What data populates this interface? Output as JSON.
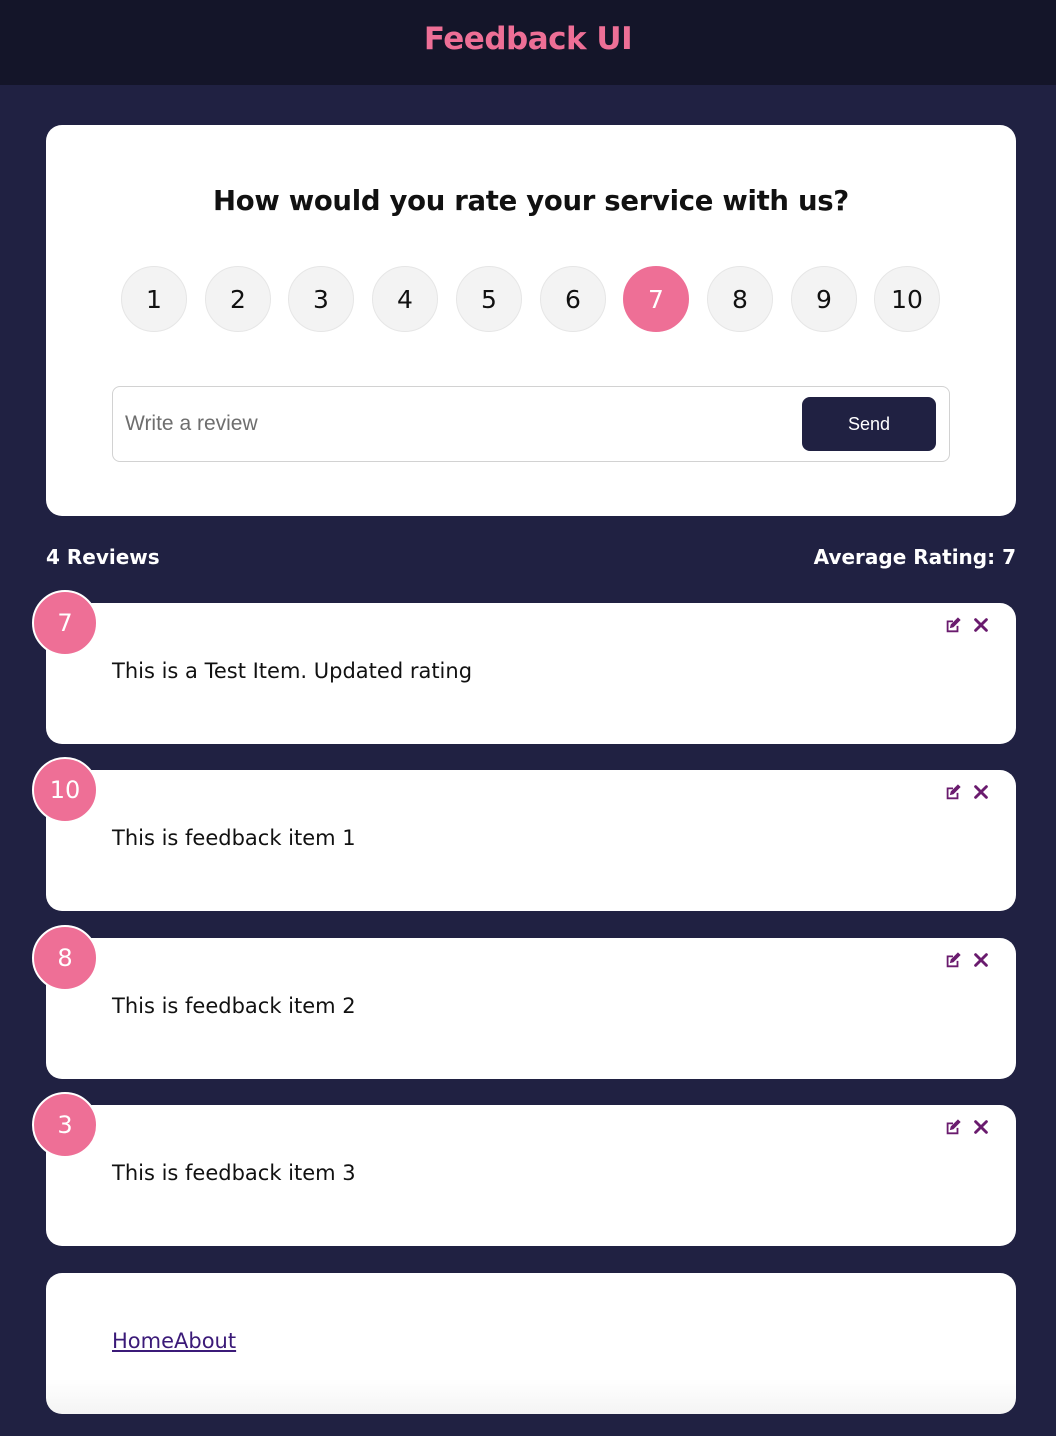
{
  "header": {
    "title": "Feedback UI"
  },
  "form": {
    "title": "How would you rate your service with us?",
    "ratings": [
      "1",
      "2",
      "3",
      "4",
      "5",
      "6",
      "7",
      "8",
      "9",
      "10"
    ],
    "selected_rating": "7",
    "review_placeholder": "Write a review",
    "send_label": "Send"
  },
  "stats": {
    "count_label": "4 Reviews",
    "average_label": "Average Rating: 7"
  },
  "items": [
    {
      "rating": "7",
      "text": "This is a Test Item. Updated rating"
    },
    {
      "rating": "10",
      "text": "This is feedback item 1"
    },
    {
      "rating": "8",
      "text": "This is feedback item 2"
    },
    {
      "rating": "3",
      "text": "This is feedback item 3"
    }
  ],
  "footer": {
    "home_label": "Home",
    "about_label": "About"
  },
  "colors": {
    "accent": "#ee6f96",
    "background": "#202142",
    "header_bg": "#141529",
    "icon": "#6a1b6e"
  },
  "icons": {
    "edit": "edit-icon",
    "close": "close-icon"
  }
}
